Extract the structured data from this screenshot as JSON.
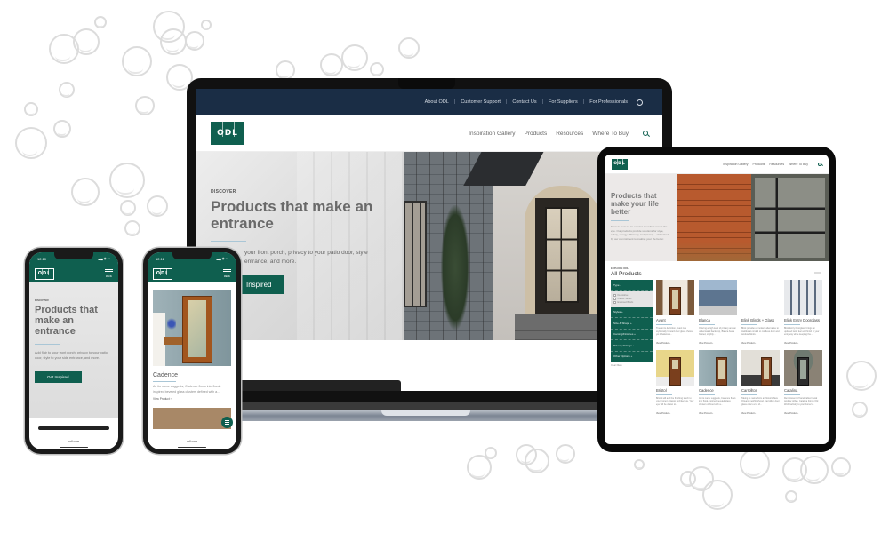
{
  "brand": {
    "logo_text": "ODL",
    "primary_color": "#0f5f4f",
    "topbar_color": "#1a2d45"
  },
  "laptop": {
    "utility_nav": [
      "About ODL",
      "Customer Support",
      "Contact Us",
      "For Suppliers",
      "For Professionals"
    ],
    "main_nav": [
      "Inspiration Gallery",
      "Products",
      "Resources",
      "Where To Buy"
    ],
    "hero": {
      "eyebrow": "DISCOVER",
      "title": "Products that make an entrance",
      "body": "your front porch, privacy to your patio door, style entrance, and more.",
      "cta": "Inspired"
    }
  },
  "tablet": {
    "main_nav": [
      "Inspiration Gallery",
      "Products",
      "Resources",
      "Where To Buy"
    ],
    "hero": {
      "title": "Products that make your life better",
      "body": "There's more to an exterior door than meets the eye. Our products provide solutions for style, safety, energy efficiency and privacy – all backed by our commitment to making your life better."
    },
    "section_eyebrow": "EXPLORE ODL",
    "section_title": "All Products",
    "filters": [
      {
        "label": "Type",
        "open": true,
        "options": [
          "Decorative",
          "Classic Series",
          "Enclosed Blinds"
        ]
      },
      {
        "label": "Styles",
        "open": false
      },
      {
        "label": "Size & Shape",
        "open": false
      },
      {
        "label": "Caming/Finishes",
        "open": false
      },
      {
        "label": "Privacy Ratings",
        "open": false
      },
      {
        "label": "Other Options",
        "open": false
      }
    ],
    "clear_filters": "Clear filters",
    "products": [
      {
        "name": "Avant",
        "desc": "True to its definition, Avant is a stylistically forward door glass choice, yet it balances...",
        "link": "View Product ›"
      },
      {
        "name": "Blanca",
        "desc": "Offering a high level of privacy and an understated backdrop, Blanca has a frosted, slightly...",
        "link": "View Product ›"
      },
      {
        "name": "Blink Blinds + Glass",
        "desc": "Blink provides a modern alternative to traditional corded or cordless door and window blinds.",
        "link": "View Product ›"
      },
      {
        "name": "Blink Entry Doorglass",
        "desc": "Blink Entry Doorglass brings an updated look, feel and finish to your entryway while keeping the...",
        "link": "View Product ›"
      },
      {
        "name": "Bristol",
        "desc": "Bristol will add the finishing touch to your home's Classic architecture. Your eye will be drawn to...",
        "link": "View Product ›"
      },
      {
        "name": "Cadence",
        "desc": "As its name suggests, Cadence flows into floral-inspired beveled glass clusters defined with a...",
        "link": "View Product ›"
      },
      {
        "name": "Carrollton",
        "desc": "Taking its name from an historic New Orleans neighborhood, Carrollton door glass offers a lot of...",
        "link": "View Product ›"
      },
      {
        "name": "Catalina",
        "desc": "Reminiscent of handcrafted metal window grilles, Catalina brings Old World artistry to your home's...",
        "link": "View Product ›"
      }
    ]
  },
  "phone_left": {
    "time": "12:10",
    "menu_label": "MENU",
    "hero": {
      "eyebrow": "DISCOVER",
      "title": "Products that make an entrance",
      "body": "Add flair to your front porch, privacy to your patio door, style to your side entrance, and more.",
      "cta": "Get Inspired"
    },
    "url": "odl.com"
  },
  "phone_right": {
    "time": "12:12",
    "menu_label": "MENU",
    "card": {
      "title": "Cadence",
      "desc": "As its name suggests, Cadence flows into floral-inspired beveled glass clusters defined with a...",
      "link": "View Product ›"
    },
    "url": "odl.com"
  }
}
